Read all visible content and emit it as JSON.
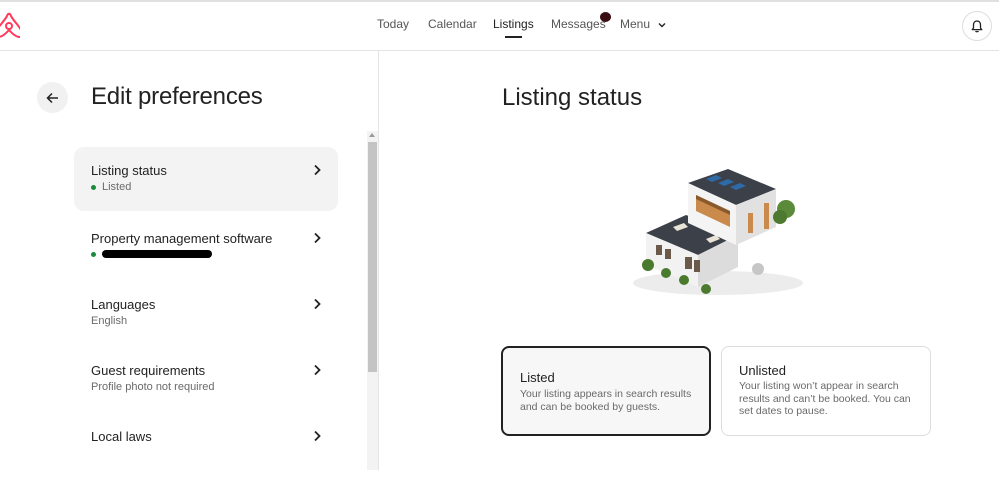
{
  "nav": {
    "items": [
      {
        "label": "Today"
      },
      {
        "label": "Calendar"
      },
      {
        "label": "Listings"
      },
      {
        "label": "Messages"
      },
      {
        "label": "Menu"
      }
    ],
    "active": "Listings"
  },
  "sidebar": {
    "title": "Edit preferences",
    "items": [
      {
        "label": "Listing status",
        "sub": "Listed",
        "status_dot": "green"
      },
      {
        "label": "Property management software",
        "sub": "",
        "status_dot": "green"
      },
      {
        "label": "Languages",
        "sub": "English"
      },
      {
        "label": "Guest requirements",
        "sub": "Profile photo not required"
      },
      {
        "label": "Local laws",
        "sub": ""
      }
    ]
  },
  "main": {
    "title": "Listing status",
    "options": [
      {
        "title": "Listed",
        "description": "Your listing appears in search results and can be booked by guests.",
        "selected": true
      },
      {
        "title": "Unlisted",
        "description": "Your listing won’t appear in search results and can’t be booked. You can set dates to pause.",
        "selected": false
      }
    ]
  },
  "colors": {
    "brand": "#ff385c",
    "status_green": "#1a8a3c",
    "text": "#222222",
    "muted": "#6a6a6a"
  },
  "icons": [
    "airbnb-logo",
    "chevron-down-icon",
    "bell-icon",
    "arrow-left-icon",
    "chevron-right-icon"
  ]
}
